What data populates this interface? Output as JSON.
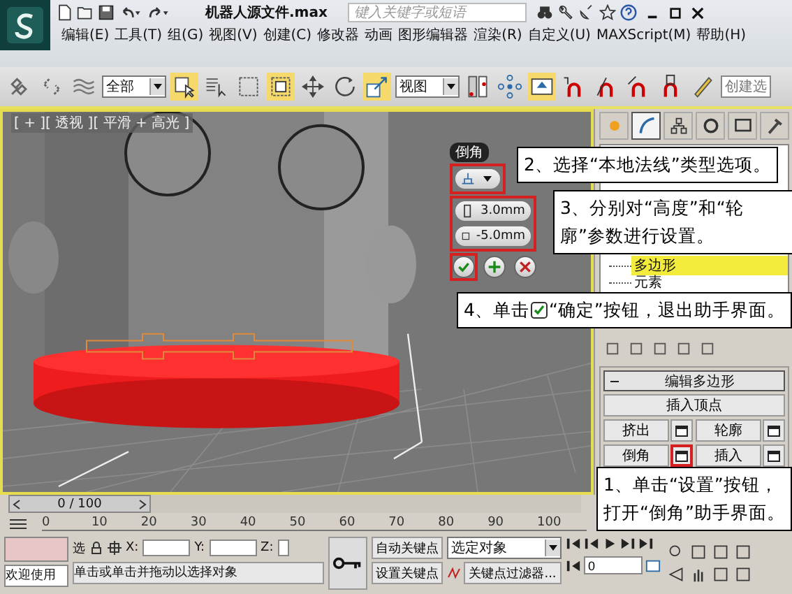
{
  "window": {
    "title": "机器人源文件.max",
    "search": {
      "placeholder": "键入关键字或短语"
    }
  },
  "menu": [
    {
      "label": "编辑(E)"
    },
    {
      "label": "工具(T)"
    },
    {
      "label": "组(G)"
    },
    {
      "label": "视图(V)"
    },
    {
      "label": "创建(C)"
    },
    {
      "label": "修改器"
    },
    {
      "label": "动画"
    },
    {
      "label": "图形编辑器"
    },
    {
      "label": "渲染(R)"
    },
    {
      "label": "自定义(U)"
    },
    {
      "label": "MAXScript(M)"
    },
    {
      "label": "帮助(H)"
    }
  ],
  "toolbar": {
    "selection_filter": "全部",
    "reference_coord": "视图",
    "named_selection": "创建选"
  },
  "viewport": {
    "label": "[ + ][ 透视 ][ 平滑 + 高光 ]"
  },
  "caddy": {
    "title": "倒角",
    "type_highlighted": true,
    "fields_highlighted": true,
    "fields": [
      {
        "value": "3.0mm"
      },
      {
        "value": "-5.0mm"
      }
    ],
    "buttons": [
      {
        "kind": "ok",
        "highlighted": true
      },
      {
        "kind": "add",
        "highlighted": false
      },
      {
        "kind": "cancel",
        "highlighted": false
      }
    ]
  },
  "callouts": [
    {
      "parts": [
        "2、选择“本地法线”类型选项。"
      ]
    },
    {
      "parts": [
        "3、分别对“高度”和“轮廓”参数进行设置。"
      ]
    },
    {
      "parts": [
        "4、单击",
        "“确定”按钮，退出助手界面。"
      ]
    },
    {
      "parts": [
        "1、单击“设置”按钮，打开“倒角”助手界面。"
      ]
    }
  ],
  "command_panel": {
    "tabs": [
      {
        "selected": false
      },
      {
        "selected": true
      },
      {
        "selected": false
      },
      {
        "selected": false
      },
      {
        "selected": false
      },
      {
        "selected": false
      }
    ],
    "stack": [
      {
        "label": "多边形",
        "selected": true
      },
      {
        "label": "元素",
        "selected": false
      }
    ],
    "rollout": {
      "title": "编辑多边形",
      "rows": [
        [
          {
            "label": "插入顶点",
            "settings": false
          }
        ],
        [
          {
            "label": "挤出",
            "settings": true,
            "highlighted": false
          },
          {
            "label": "轮廓",
            "settings": true,
            "highlighted": false
          }
        ],
        [
          {
            "label": "倒角",
            "settings": true,
            "highlighted": true
          },
          {
            "label": "插入",
            "settings": true,
            "highlighted": false
          }
        ]
      ]
    }
  },
  "timeline": {
    "frame": "0 / 100",
    "level": 0,
    "ticks": [
      "0",
      "10",
      "20",
      "30",
      "40",
      "50",
      "60",
      "70",
      "80",
      "90",
      "100"
    ]
  },
  "status": {
    "welcome": "欢迎使用",
    "select_label": "选",
    "x_label": "X:",
    "y_label": "Y:",
    "z_label": "Z:",
    "prompt": "单击或单击并拖动以选择对象",
    "auto_key": "自动关键点",
    "set_key": "设置关键点",
    "key_mode": "选定对象",
    "key_filters": "关键点过滤器...",
    "current_frame": "0"
  }
}
